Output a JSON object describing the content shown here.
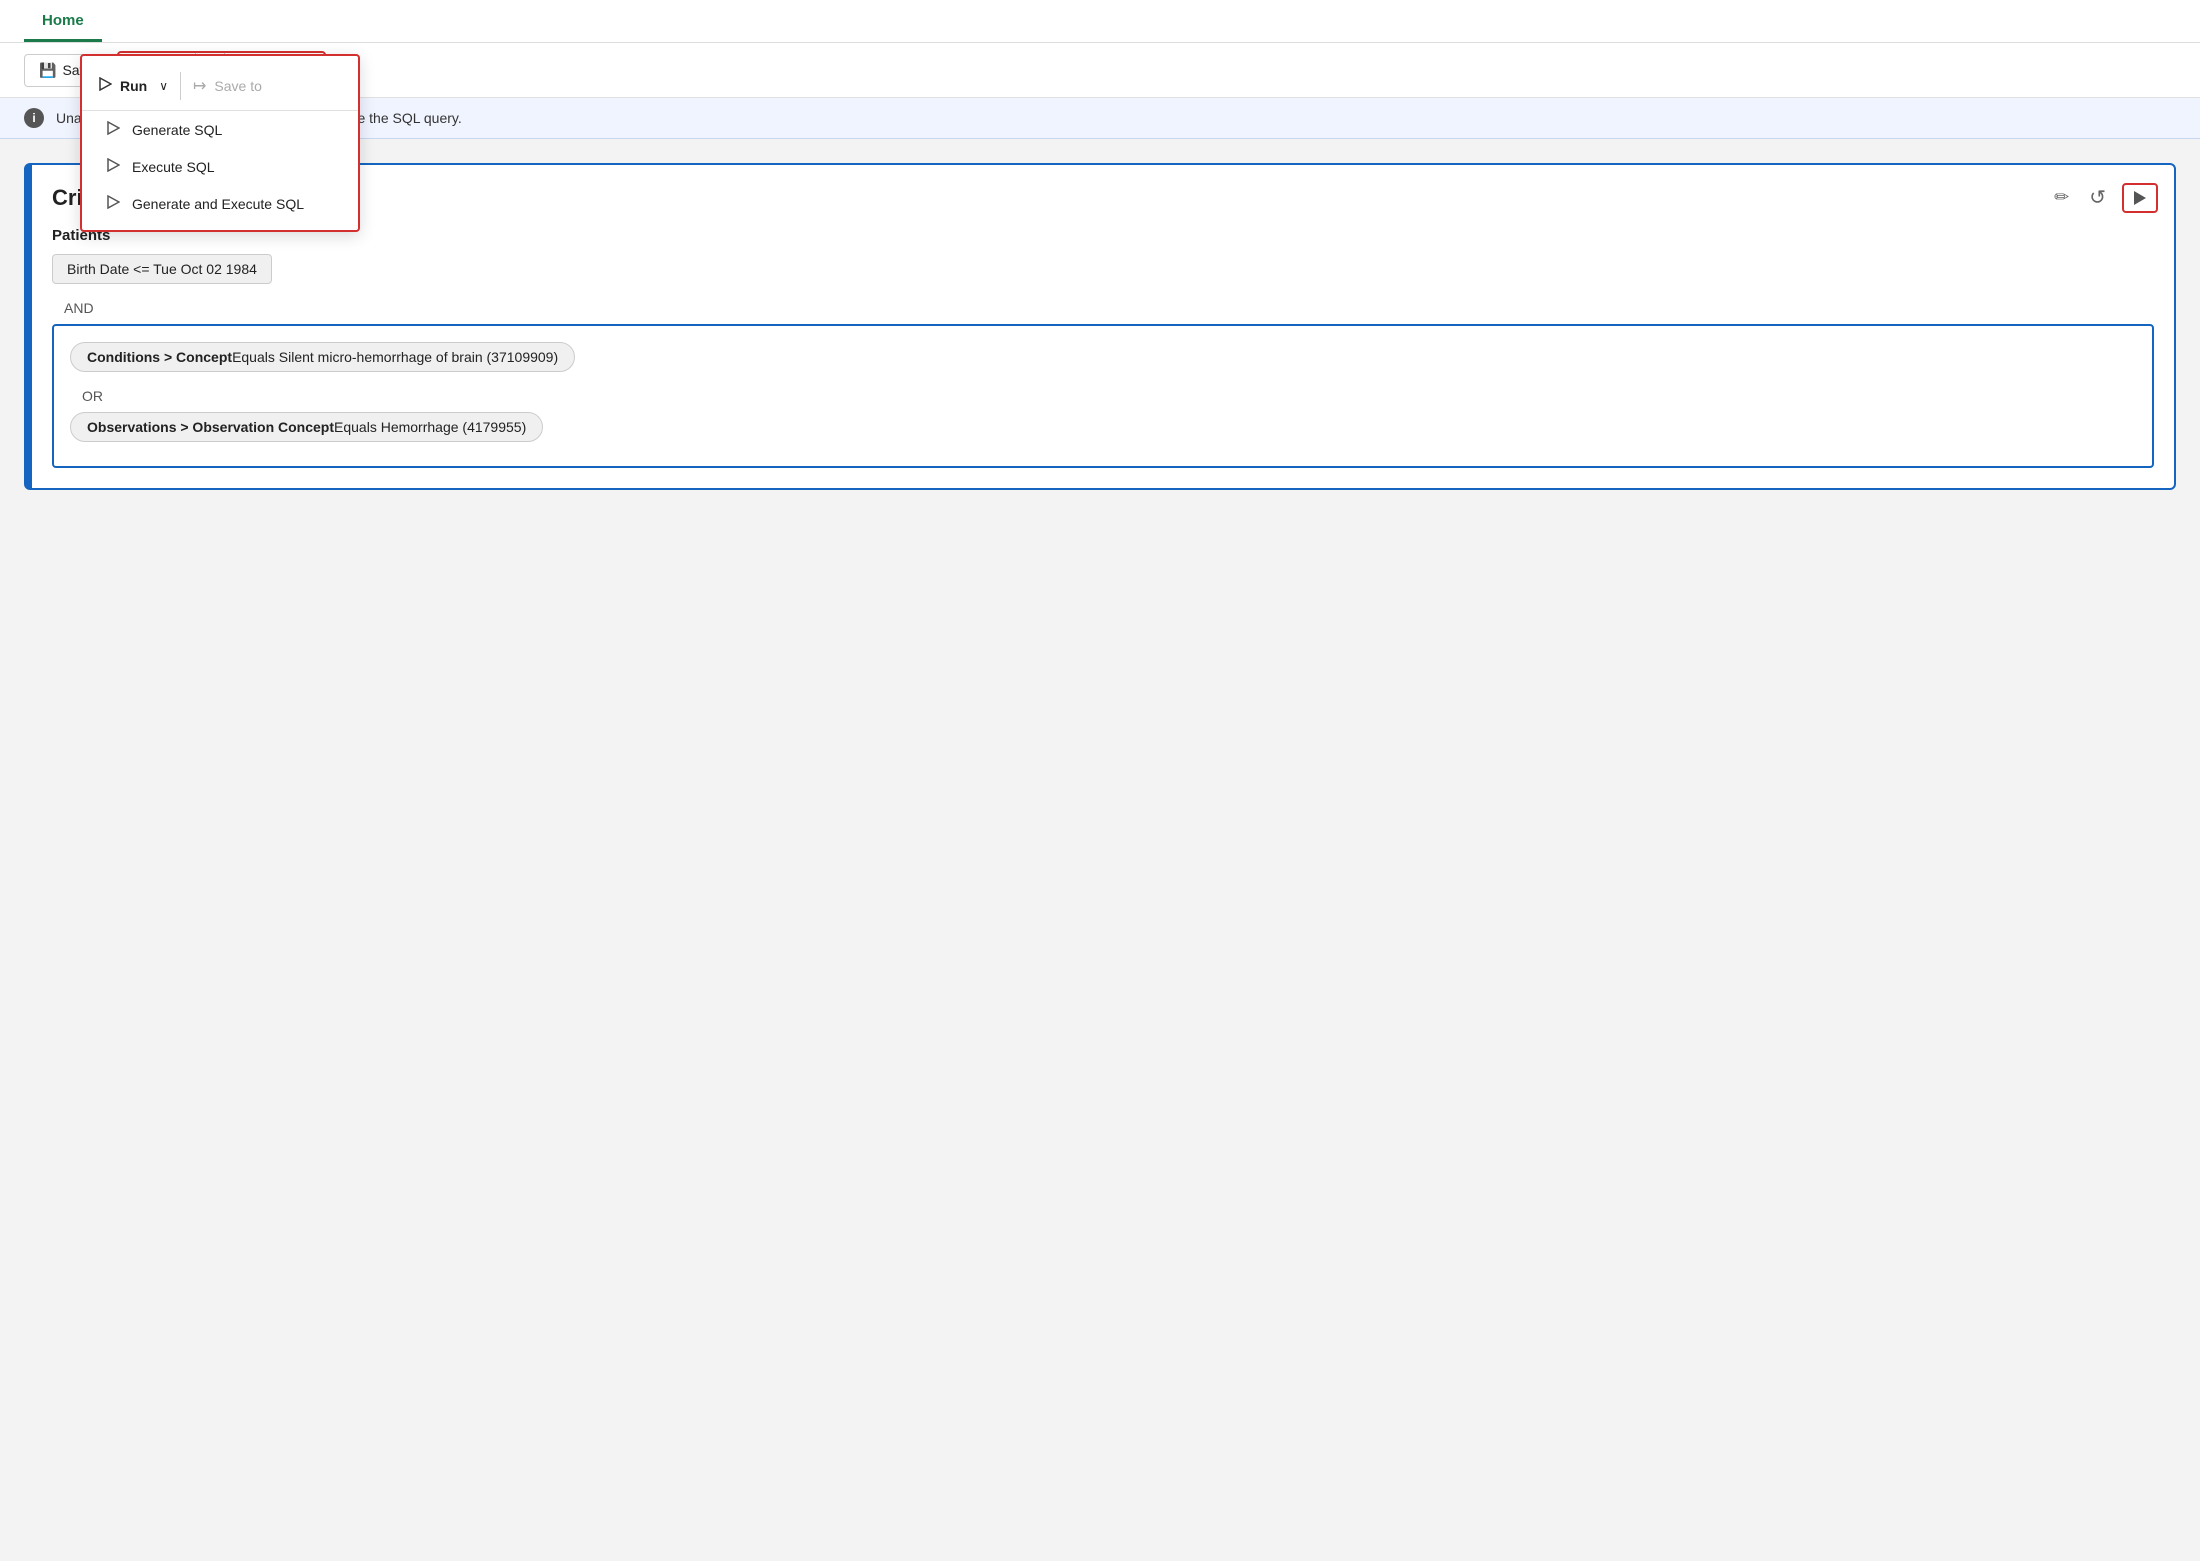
{
  "tabs": [
    {
      "id": "home",
      "label": "Home",
      "active": true
    }
  ],
  "toolbar": {
    "save_label": "Save",
    "run_label": "Run",
    "save_to_label": "Save to",
    "chevron": "∨"
  },
  "dropdown": {
    "items": [
      {
        "id": "generate-sql",
        "label": "Generate SQL"
      },
      {
        "id": "execute-sql",
        "label": "Execute SQL"
      },
      {
        "id": "generate-execute-sql",
        "label": "Generate and Execute SQL"
      }
    ]
  },
  "info_banner": {
    "text": "Unapplied changes. Run Generate SQL to update the SQL query."
  },
  "criteria": {
    "title": "Crite",
    "section_label": "Patients",
    "birth_date_tag": "Birth Date  <=  Tue Oct 02 1984",
    "and_label": "AND",
    "or_label": "OR",
    "nested_conditions_tag_bold": "Conditions > Concept",
    "nested_conditions_tag_text": " Equals Silent micro-hemorrhage of brain (37109909)",
    "nested_observations_tag_bold": "Observations > Observation Concept",
    "nested_observations_tag_text": " Equals Hemorrhage (4179955)"
  },
  "icons": {
    "save": "💾",
    "info": "i",
    "pencil": "✏",
    "undo": "↺",
    "play_outline": "▷"
  }
}
